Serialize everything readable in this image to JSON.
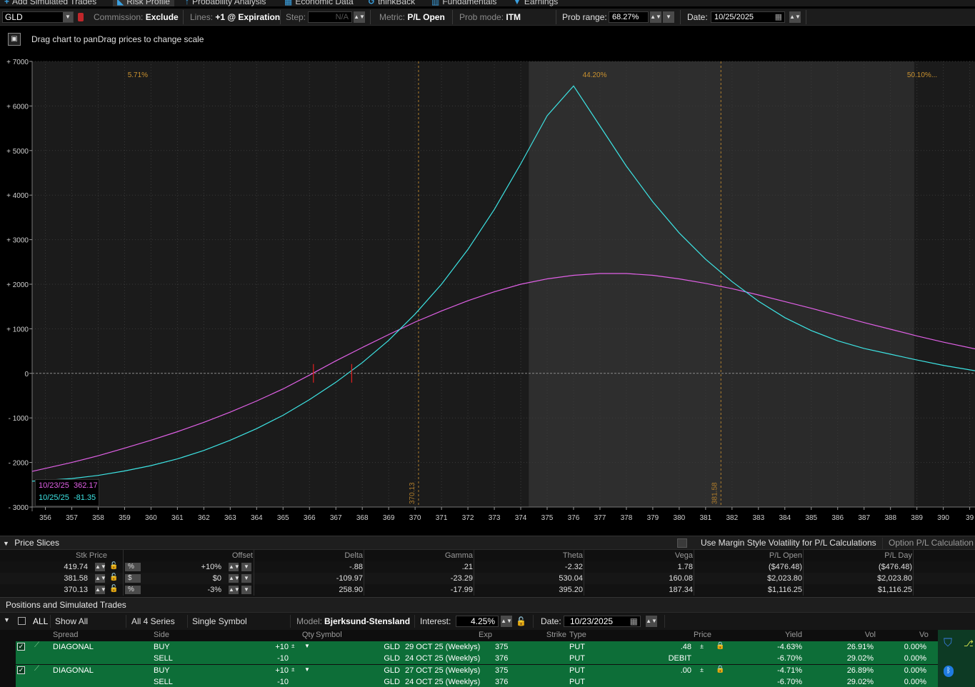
{
  "tabs": [
    {
      "label": "Add Simulated Trades",
      "icon": "plus-icon",
      "x": 6
    },
    {
      "label": "Risk Profile",
      "icon": "risk-profile-icon",
      "x": 158,
      "active": true
    },
    {
      "label": "Probability Analysis",
      "icon": "probability-icon",
      "x": 259
    },
    {
      "label": "Economic Data",
      "icon": "economic-icon",
      "x": 398
    },
    {
      "label": "thinkBack",
      "icon": "thinkback-icon",
      "x": 515
    },
    {
      "label": "Fundamentals",
      "icon": "fundamentals-icon",
      "x": 604
    },
    {
      "label": "Earnings",
      "icon": "earnings-icon",
      "x": 718
    }
  ],
  "toolbar": {
    "symbol": "GLD",
    "commission_label": "Commission:",
    "commission_value": "Exclude",
    "lines_label": "Lines:",
    "lines_value": "+1 @ Expiration",
    "step_label": "Step:",
    "step_value": "N/A",
    "metric_label": "Metric:",
    "metric_value": "P/L Open",
    "prob_mode_label": "Prob mode:",
    "prob_mode_value": "ITM",
    "prob_range_label": "Prob range:",
    "prob_range_value": "68.27%",
    "date_label": "Date:",
    "date_value": "10/25/2025"
  },
  "info": {
    "text": "Drag chart to panDrag prices to change scale"
  },
  "chart_data": {
    "type": "line",
    "xlim": [
      355.5,
      391.2
    ],
    "ylim": [
      -3000,
      7000
    ],
    "x_ticks": [
      356,
      357,
      358,
      359,
      360,
      361,
      362,
      363,
      364,
      365,
      366,
      367,
      368,
      369,
      370,
      371,
      372,
      373,
      374,
      375,
      376,
      377,
      378,
      379,
      380,
      381,
      382,
      383,
      384,
      385,
      386,
      387,
      388,
      389,
      390,
      391
    ],
    "x_tick_labels": [
      "356",
      "357",
      "358",
      "359",
      "360",
      "361",
      "362",
      "363",
      "364",
      "365",
      "366",
      "367",
      "368",
      "369",
      "370",
      "371",
      "372",
      "373",
      "374",
      "375",
      "376",
      "377",
      "378",
      "379",
      "380",
      "381",
      "382",
      "383",
      "384",
      "385",
      "386",
      "387",
      "388",
      "389",
      "390",
      "39"
    ],
    "y_ticks": [
      7000,
      6000,
      5000,
      4000,
      3000,
      2000,
      1000,
      0,
      -1000,
      -2000,
      -3000
    ],
    "y_tick_labels": [
      "+ 7000",
      "+ 6000",
      "+ 5000",
      "+ 4000",
      "+ 3000",
      "+ 2000",
      "+ 1000",
      "0",
      "- 1000",
      "- 2000",
      "- 3000"
    ],
    "probability_labels": [
      {
        "x": 359.5,
        "text": "5.71%"
      },
      {
        "x": 376.8,
        "text": "44.20%"
      },
      {
        "x": 389.2,
        "text": "50.10%..."
      }
    ],
    "vertical_markers": [
      {
        "x": 370.13,
        "label": "370.13"
      },
      {
        "x": 381.58,
        "label": "381.58"
      }
    ],
    "shaded_regions": [
      {
        "x0": 374.3,
        "x1": 381.58,
        "shade": "#2e2e2e"
      },
      {
        "x0": 381.58,
        "x1": 388.9,
        "shade": "#2a2a2a"
      },
      {
        "x0": 355.5,
        "x1": 374.3,
        "shade": "#1b1b1b"
      },
      {
        "x0": 388.9,
        "x1": 391.2,
        "shade": "#1b1b1b"
      }
    ],
    "breakeven_marks": [
      366.15,
      367.6
    ],
    "series": [
      {
        "name": "10/23/25",
        "color": "#e060e6",
        "x": [
          355.5,
          357,
          358,
          359,
          360,
          361,
          362,
          363,
          364,
          365,
          366,
          367,
          368,
          369,
          370,
          371,
          372,
          373,
          374,
          375,
          376,
          377,
          378,
          379,
          380,
          381,
          382,
          383,
          384,
          385,
          386,
          387,
          388,
          389,
          390,
          391.2
        ],
        "y": [
          -2200,
          -2000,
          -1850,
          -1680,
          -1500,
          -1310,
          -1100,
          -870,
          -620,
          -350,
          -40,
          280,
          580,
          870,
          1150,
          1400,
          1630,
          1830,
          2000,
          2120,
          2200,
          2240,
          2240,
          2200,
          2120,
          2020,
          1900,
          1760,
          1610,
          1460,
          1300,
          1140,
          990,
          840,
          700,
          550
        ]
      },
      {
        "name": "10/25/25",
        "color": "#3de4e4",
        "x": [
          355.5,
          357,
          358,
          359,
          360,
          361,
          362,
          363,
          364,
          365,
          366,
          367,
          368,
          369,
          370,
          371,
          372,
          373,
          374,
          375,
          376,
          377,
          378,
          379,
          380,
          381,
          382,
          383,
          384,
          385,
          386,
          387,
          388,
          389,
          390,
          391.2
        ],
        "y": [
          -2420,
          -2360,
          -2290,
          -2190,
          -2070,
          -1920,
          -1730,
          -1500,
          -1240,
          -940,
          -590,
          -200,
          240,
          740,
          1330,
          2000,
          2780,
          3680,
          4700,
          5780,
          6450,
          5550,
          4650,
          3850,
          3150,
          2560,
          2060,
          1620,
          1250,
          960,
          730,
          560,
          430,
          300,
          180,
          60
        ]
      }
    ],
    "legend": [
      {
        "date": "10/23/25",
        "value": "362.17"
      },
      {
        "date": "10/25/25",
        "value": "-81.35"
      }
    ]
  },
  "price_slices": {
    "title": "Price Slices",
    "margin_option": "Use Margin Style Volatility for P/L Calculations",
    "option_calc": "Option P/L Calculation",
    "headers": {
      "stk_price": "Stk Price",
      "offset": "Offset",
      "delta": "Delta",
      "gamma": "Gamma",
      "theta": "Theta",
      "vega": "Vega",
      "pl_open": "P/L Open",
      "pl_day": "P/L Day"
    },
    "rows": [
      {
        "stk_price": "419.74",
        "unit": "%",
        "offset": "+10%",
        "delta": "-.88",
        "gamma": ".21",
        "theta": "-2.32",
        "vega": "1.78",
        "pl_open": "($476.48)",
        "pl_day": "($476.48)"
      },
      {
        "stk_price": "381.58",
        "unit": "$",
        "offset": "$0",
        "delta": "-109.97",
        "gamma": "-23.29",
        "theta": "530.04",
        "vega": "160.08",
        "pl_open": "$2,023.80",
        "pl_day": "$2,023.80"
      },
      {
        "stk_price": "370.13",
        "unit": "%",
        "offset": "-3%",
        "delta": "258.90",
        "gamma": "-17.99",
        "theta": "395.20",
        "vega": "187.34",
        "pl_open": "$1,116.25",
        "pl_day": "$1,116.25"
      }
    ]
  },
  "positions": {
    "title": "Positions and Simulated Trades",
    "all_label": "ALL",
    "show_all": "Show All",
    "series": "All 4 Series",
    "symbol_mode": "Single Symbol",
    "model_label": "Model:",
    "model_value": "Bjerksund-Stensland",
    "interest_label": "Interest:",
    "interest_value": "4.25%",
    "date_label": "Date:",
    "date_value": "10/23/2025",
    "headers": {
      "spread": "Spread",
      "side": "Side",
      "qty": "Qty",
      "symbol": "Symbol",
      "exp": "Exp",
      "strike": "Strike",
      "type": "Type",
      "price": "Price",
      "yield": "Yield",
      "vol": "Vol",
      "vo": "Vo"
    },
    "rows": [
      {
        "spread": "DIAGONAL",
        "side": "BUY",
        "qty": "+10",
        "symbol": "GLD",
        "exp": "29 OCT 25 (Weeklys)",
        "strike": "375",
        "type": "PUT",
        "price": ".48",
        "yield": "-4.63%",
        "vol": "26.91%",
        "vo": "0.00%",
        "checked": true
      },
      {
        "spread": "",
        "side": "SELL",
        "qty": "-10",
        "symbol": "GLD",
        "exp": "24 OCT 25 (Weeklys)",
        "strike": "376",
        "type": "PUT",
        "price": "DEBIT",
        "yield": "-6.70%",
        "vol": "29.02%",
        "vo": "0.00%",
        "checked": false
      },
      {
        "spread": "DIAGONAL",
        "side": "BUY",
        "qty": "+10",
        "symbol": "GLD",
        "exp": "27 OCT 25 (Weeklys)",
        "strike": "375",
        "type": "PUT",
        "price": ".00",
        "yield": "-4.71%",
        "vol": "26.89%",
        "vo": "0.00%",
        "checked": true
      },
      {
        "spread": "",
        "side": "SELL",
        "qty": "-10",
        "symbol": "GLD",
        "exp": "24 OCT 25 (Weeklys)",
        "strike": "376",
        "type": "PUT",
        "price": "",
        "yield": "-6.70%",
        "vol": "29.02%",
        "vo": "0.00%",
        "checked": false
      }
    ]
  }
}
